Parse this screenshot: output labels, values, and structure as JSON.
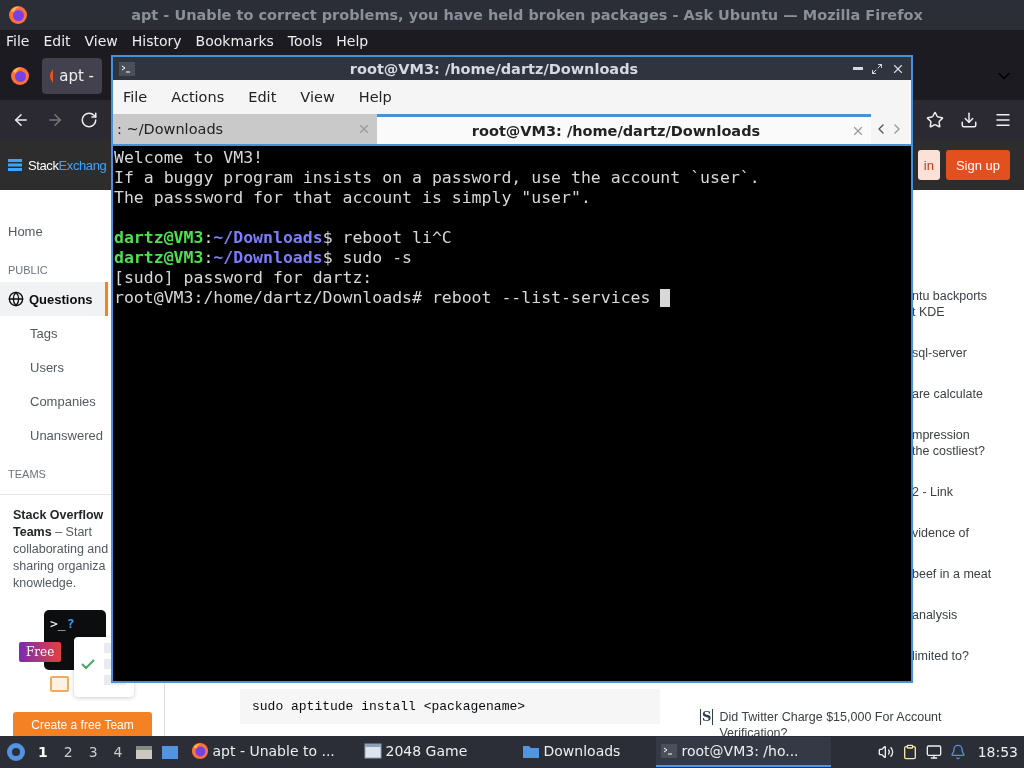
{
  "browser": {
    "title": "apt - Unable to correct problems, you have held broken packages - Ask Ubuntu — Mozilla Firefox",
    "menu": [
      "File",
      "Edit",
      "View",
      "History",
      "Bookmarks",
      "Tools",
      "Help"
    ],
    "tab": {
      "label": "apt -",
      "selected": true
    },
    "site_header": {
      "logo": "Stack",
      "logo_accent": "Exchang",
      "login": "in",
      "signup": "Sign up"
    },
    "left_nav": [
      {
        "label": "Home",
        "kind": "top",
        "selected": false
      },
      {
        "label": "PUBLIC",
        "kind": "heading",
        "selected": false
      },
      {
        "label": "Questions",
        "kind": "top",
        "selected": true
      },
      {
        "label": "Tags",
        "kind": "sub",
        "selected": false
      },
      {
        "label": "Users",
        "kind": "sub",
        "selected": false
      },
      {
        "label": "Companies",
        "kind": "sub",
        "selected": false
      },
      {
        "label": "Unanswered",
        "kind": "sub",
        "selected": false
      },
      {
        "label": "TEAMS",
        "kind": "heading",
        "selected": false
      }
    ],
    "teams_card": {
      "lines": [
        "**Stack Overflow**",
        "**Teams** – Start",
        "collaborating and",
        "sharing organiza",
        "knowledge."
      ],
      "prompt": ">_",
      "question": "?",
      "badge": "Free",
      "button": "Create a free Team"
    },
    "main": {
      "code": "sudo aptitude install <packagename>"
    },
    "right_sidebar": {
      "fragments": [
        {
          "lines": [
            "ntu backports",
            "t KDE"
          ]
        },
        {
          "lines": [
            "sql-server"
          ]
        },
        {
          "lines": [
            "are calculate"
          ]
        },
        {
          "lines": [
            "mpression",
            "the costliest?"
          ]
        },
        {
          "lines": [
            "2 - Link"
          ]
        },
        {
          "lines": [
            "vidence of"
          ]
        },
        {
          "lines": [
            "beef in a meat"
          ]
        },
        {
          "lines": [
            "analysis"
          ]
        },
        {
          "lines": [
            "limited to?"
          ]
        }
      ],
      "hot_question": {
        "site": "S",
        "title": "Did Twitter Charge $15,000 For Account Verification?"
      }
    }
  },
  "terminal": {
    "title": "root@VM3: /home/dartz/Downloads",
    "menu": [
      "File",
      "Actions",
      "Edit",
      "View",
      "Help"
    ],
    "tabs": [
      {
        "label": ": ~/Downloads",
        "selected": false
      },
      {
        "label": "root@VM3: /home/dartz/Downloads",
        "selected": true
      }
    ],
    "lines": [
      {
        "kind": "text",
        "text": "Welcome to VM3!"
      },
      {
        "kind": "text",
        "text": "If a buggy program insists on a password, use the account `user`."
      },
      {
        "kind": "text",
        "text": "The passsword for that account is simply \"user\"."
      },
      {
        "kind": "blank"
      },
      {
        "kind": "prompt",
        "user": "dartz@VM3",
        "sep": ":",
        "path": "~/Downloads",
        "command": "$ reboot li^C"
      },
      {
        "kind": "prompt",
        "user": "dartz@VM3",
        "sep": ":",
        "path": "~/Downloads",
        "command": "$ sudo -s"
      },
      {
        "kind": "text",
        "text": "[sudo] password for dartz:"
      },
      {
        "kind": "text",
        "text": "root@VM3:/home/dartz/Downloads# reboot --list-services",
        "cursor": true
      }
    ]
  },
  "taskbar": {
    "workspaces": [
      {
        "label": "1",
        "selected": true
      },
      {
        "label": "2",
        "selected": false
      },
      {
        "label": "3",
        "selected": false
      },
      {
        "label": "4",
        "selected": false
      }
    ],
    "tasks": [
      {
        "label": "apt - Unable to ...",
        "kind": "firefox",
        "selected": false
      },
      {
        "label": "2048 Game",
        "kind": "window",
        "selected": false
      },
      {
        "label": "Downloads",
        "kind": "folder",
        "selected": false
      },
      {
        "label": "root@VM3: /ho...",
        "kind": "terminal",
        "selected": true
      }
    ],
    "clock": "18:53"
  }
}
